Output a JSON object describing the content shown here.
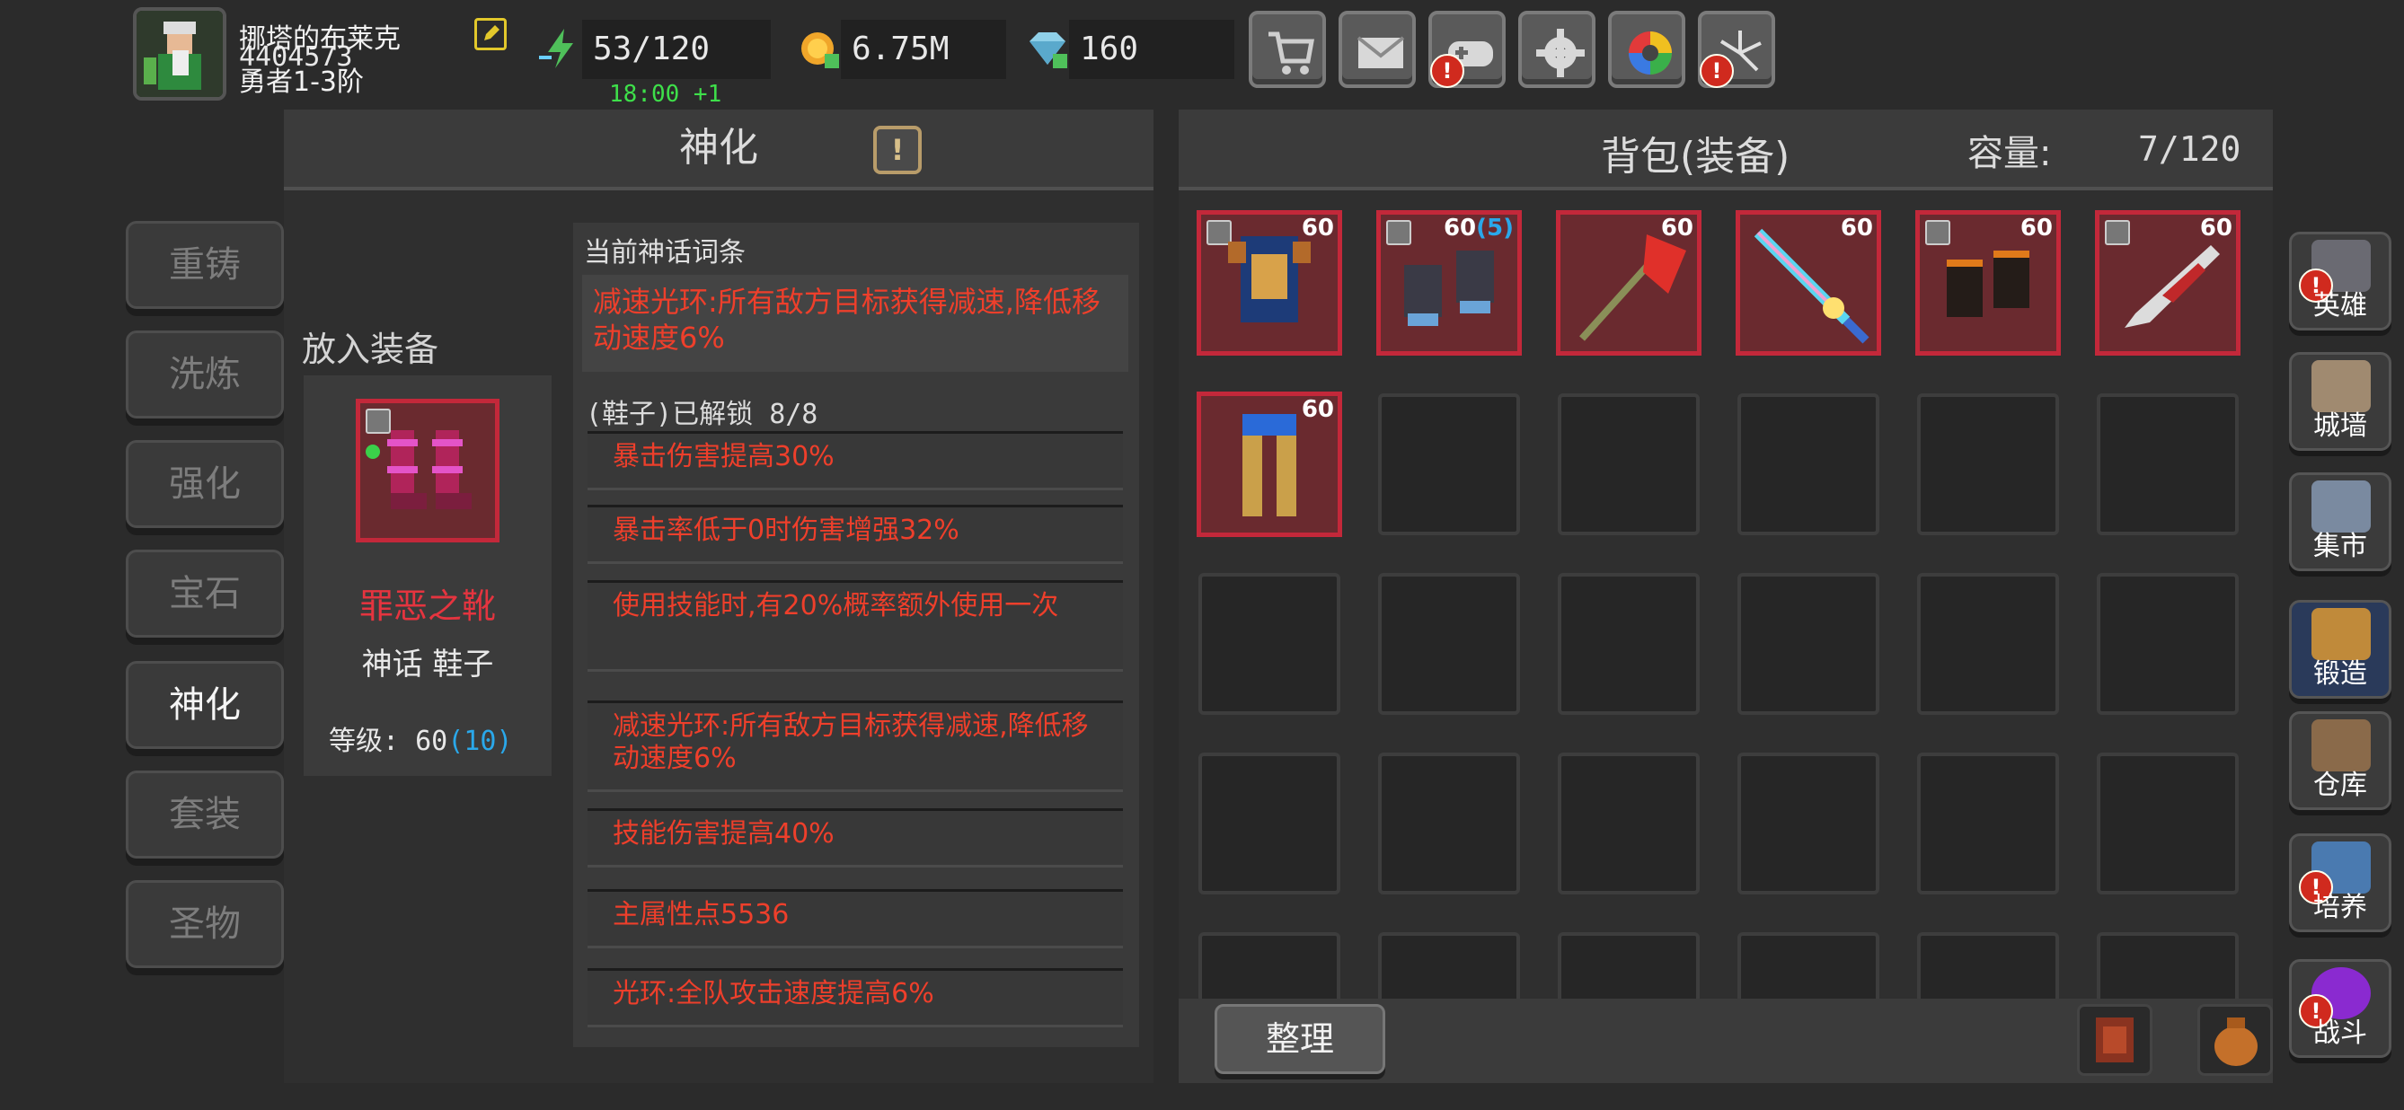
{
  "player": {
    "name": "挪塔的布莱克",
    "id": "4404573",
    "rank": "勇者1-3阶"
  },
  "resources": {
    "energy": "53/120",
    "energy_timer": "18:00 +1",
    "gold": "6.75M",
    "diamond": "160"
  },
  "top_buttons": [
    "shop",
    "mail",
    "gamepad",
    "settings",
    "gallery",
    "fireworks"
  ],
  "left_tabs": [
    "重铸",
    "洗炼",
    "强化",
    "宝石",
    "神化",
    "套装",
    "圣物"
  ],
  "deify": {
    "title": "神化",
    "put_label": "放入装备",
    "item_name": "罪恶之靴",
    "item_type": "神话 鞋子",
    "level_label": "等级:",
    "level_value": "60",
    "level_bonus": "(10)",
    "current_title": "当前神话词条",
    "current_text": "减速光环:所有敌方目标获得减速,降低移动速度6%",
    "unlocked_label": "(鞋子)已解锁",
    "unlocked_count": "8/8",
    "attributes": [
      "暴击伤害提高30%",
      "暴击率低于0时伤害增强32%",
      "使用技能时,有20%概率额外使用一次",
      "减速光环:所有敌方目标获得减速,降低移动速度6%",
      "技能伤害提高40%",
      "主属性点5536",
      "光环:全队攻击速度提高6%"
    ]
  },
  "bag": {
    "title": "背包(装备)",
    "capacity_label": "容量:",
    "capacity_value": "7/120",
    "items": [
      {
        "level": "60",
        "extra": "",
        "kind": "armor"
      },
      {
        "level": "60",
        "extra": "(5)",
        "kind": "gloves"
      },
      {
        "level": "60",
        "extra": "",
        "kind": "axe"
      },
      {
        "level": "60",
        "extra": "",
        "kind": "sword"
      },
      {
        "level": "60",
        "extra": "",
        "kind": "gauntlet"
      },
      {
        "level": "60",
        "extra": "",
        "kind": "knife"
      },
      {
        "level": "60",
        "extra": "",
        "kind": "legs"
      }
    ],
    "sort_label": "整理"
  },
  "right_nav": [
    "英雄",
    "城墙",
    "集市",
    "锻造",
    "仓库",
    "培养",
    "战斗"
  ]
}
